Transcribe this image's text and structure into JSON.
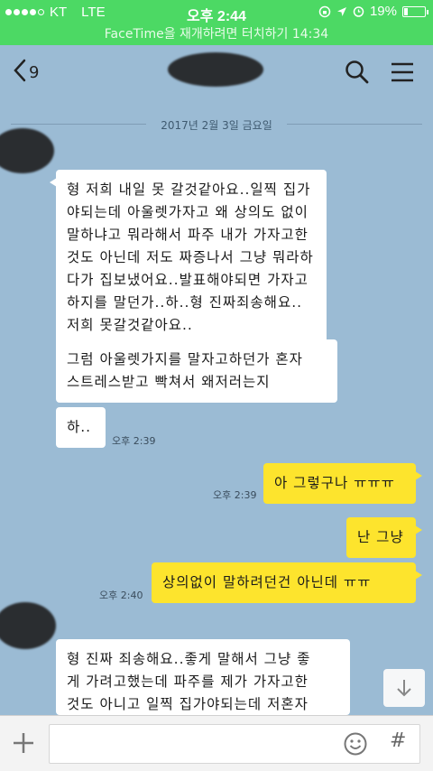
{
  "status": {
    "carrier": "KT",
    "network": "LTE",
    "time": "오후 2:44",
    "battery": "19%",
    "battery_level": 0.19
  },
  "facetime_banner": "FaceTime을 재개하려면 터치하기 14:34",
  "header": {
    "back_count": "9",
    "icons": [
      "back-chevron-icon",
      "search-icon",
      "menu-icon"
    ]
  },
  "date_divider": "2017년 2월 3일 금요일",
  "messages": [
    {
      "side": "left",
      "text": "형 저희 내일 못 갈것같아요..일찍 집가\n야되는데 아울렛가자고 왜 상의도 없이\n말하냐고 뭐라해서 파주 내가 가자고한\n것도 아닌데 저도 짜증나서 그냥 뭐라하\n다가 집보냈어요..발표해야되면 가자고\n하지를 말던가..하..형 진짜죄송해요..\n저희 못갈것같아요..",
      "time": ""
    },
    {
      "side": "left",
      "text": "그럼 아울렛가지를 말자고하던가 혼자\n스트레스받고 빡쳐서 왜저러는지",
      "time": ""
    },
    {
      "side": "left",
      "text": "하..",
      "time": "오후 2:39"
    },
    {
      "side": "right",
      "text": "아 그렇구나 ㅠㅠㅠ",
      "time": "오후 2:39"
    },
    {
      "side": "right",
      "text": "난 그냥",
      "time": ""
    },
    {
      "side": "right",
      "text": "상의없이 말하려던건 아닌데 ㅠㅠ",
      "time": "오후 2:40"
    },
    {
      "side": "left",
      "text": "형 진짜 죄송해요..좋게 말해서 그냥 좋\n게 가려고했는데 파주를 제가 가자고한\n것도 아니고 일찍 집가야되는데 저혼자",
      "time": ""
    }
  ],
  "input": {
    "placeholder": "",
    "hash_label": "#"
  }
}
